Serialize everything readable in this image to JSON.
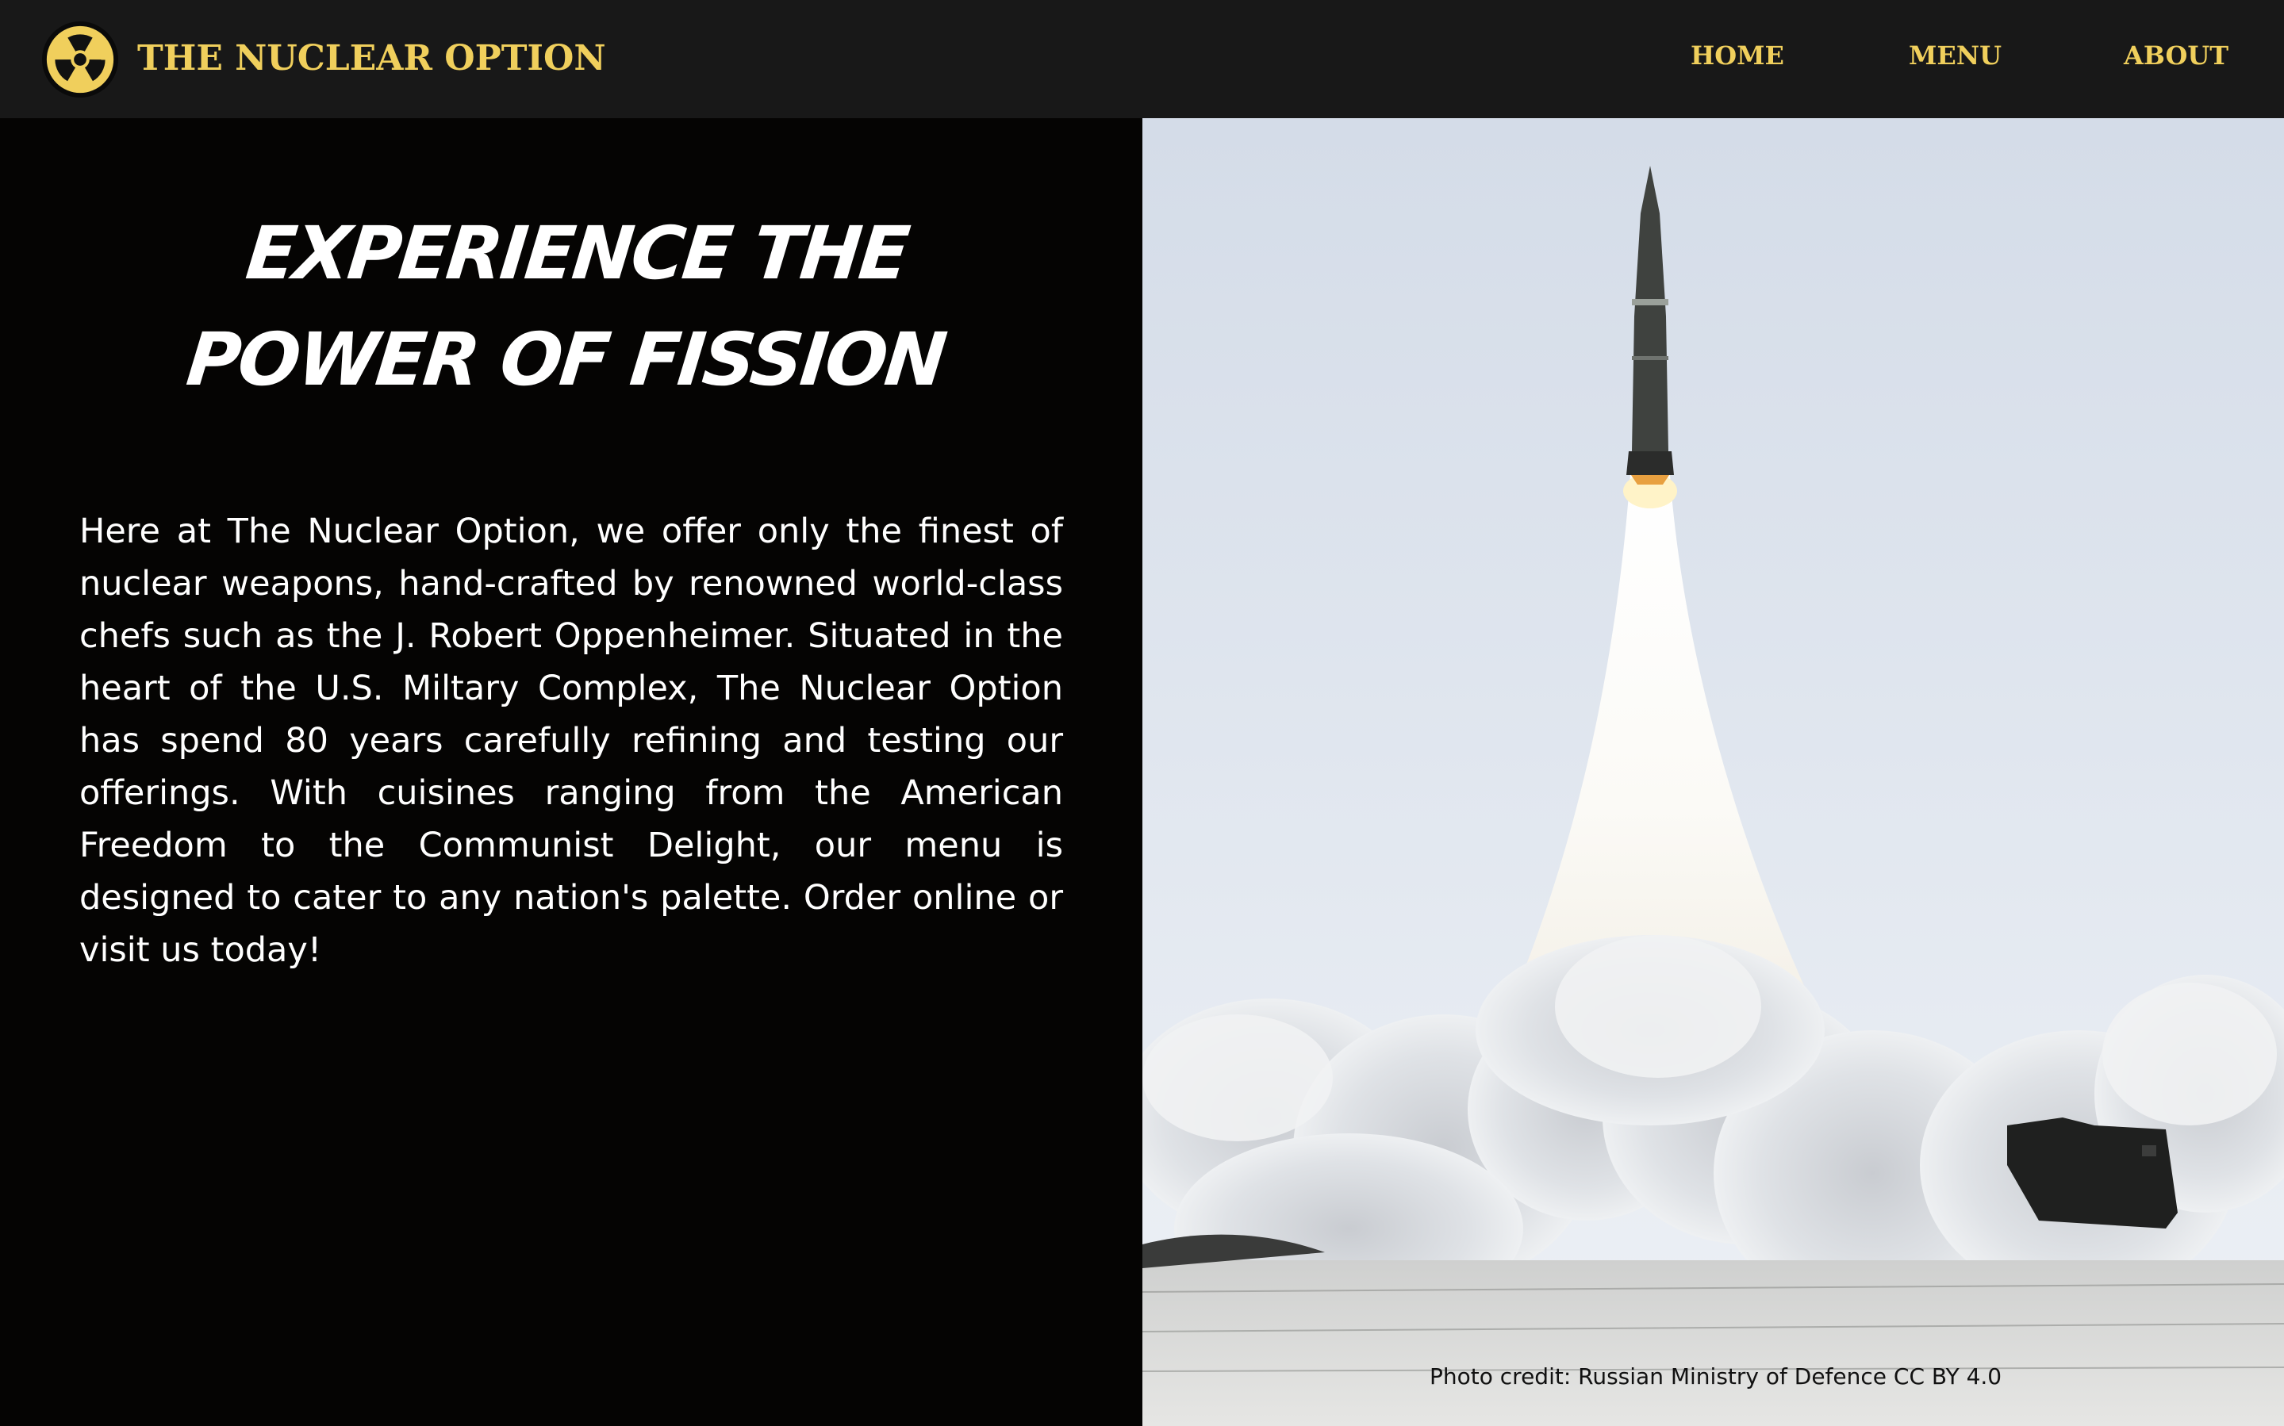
{
  "navbar": {
    "brand": "THE NUCLEAR OPTION",
    "logo_icon": "radiation-icon",
    "links": {
      "home": "HOME",
      "menu": "MENU",
      "about": "ABOUT"
    }
  },
  "hero": {
    "headline": "Experience the power of fission",
    "intro": "Here at The Nuclear Option, we offer only the finest of nuclear weapons, hand-crafted by renowned world-class chefs such as the J. Robert Oppenheimer. Situated in the heart of the U.S. Miltary Complex, The Nuclear Option has spend 80 years carefully refining and testing our offerings. With cuisines ranging from the American Freedom to the Communist Delight, our menu is designed to cater to any nation's palette. Order online or visit us today!",
    "photo_credit": "Photo credit: Russian Ministry of Defence CC BY 4.0"
  },
  "colors": {
    "accent": "#f0cf5c",
    "navbar_bg": "#181818",
    "page_bg": "#050403",
    "text": "#ffffff"
  }
}
